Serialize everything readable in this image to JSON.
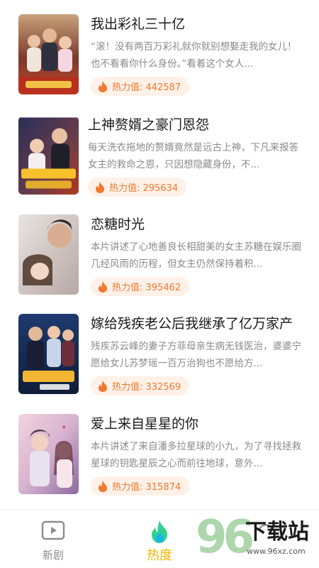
{
  "dramas": [
    {
      "title": "我出彩礼三十亿",
      "description": "“滚！没有两百万彩礼就你就别想娶走我的女儿！也不看看你什么身份。”看着这个女人...",
      "heat_label": "热力值: 442587"
    },
    {
      "title": "上神赘婿之豪门恩怨",
      "description": "每天洗衣拖地的赘婿竟然是远古上神，下凡来报答女主的救命之恩，只因想隐藏身份，不...",
      "heat_label": "热力值: 295634"
    },
    {
      "title": "恋糖时光",
      "description": "本片讲述了心地善良长相甜美的女主苏糖在娱乐圈几经风雨的历程，但女主仍然保持着积...",
      "heat_label": "热力值: 395462"
    },
    {
      "title": "嫁给残疾老公后我继承了亿万家产",
      "description": "残疾苏云峰的妻子方菲母亲生病无钱医治，婆婆宁愿给女儿苏梦瑶一百万治狗也不愿给方...",
      "heat_label": "热力值: 332569"
    },
    {
      "title": "爱上来自星星的你",
      "description": "本片讲述了来自潘多拉星球的小九，为了寻找拯救星球的钥匙星辰之心而前往地球，意外...",
      "heat_label": "热力值: 315874"
    }
  ],
  "tabbar": {
    "new_label": "新剧",
    "hot_label": "热度"
  },
  "colors": {
    "accent": "#f6b400",
    "heat_text": "#f2782d",
    "heat_bg": "#fff1e8"
  },
  "watermark": {
    "number": "96",
    "text": "下载站",
    "url": "www.96xz.com"
  }
}
